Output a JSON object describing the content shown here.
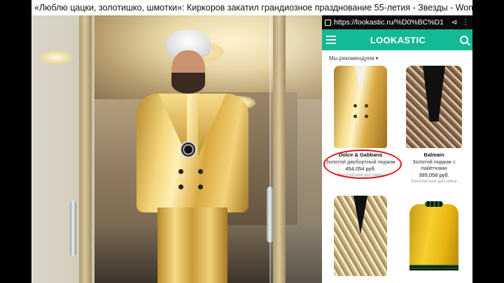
{
  "headline": "«Люблю цацки, золотишко, шмотки»: Киркоров закатил грандиозное празднование 55-летия - Звезды - WomanHit.ru",
  "browser": {
    "url": "https://lookastic.ru/%D0%BC%D1"
  },
  "app": {
    "brand": "LOOKASTIC",
    "sort_label": "Мы рекомендуем",
    "accent_color": "#13b894"
  },
  "products": [
    {
      "brand": "Dolce & Gabbana",
      "description": "Золотой двубортный пиджак",
      "price": "454,054 руб.",
      "shipping": "Бесплатная доставка"
    },
    {
      "brand": "Balmain",
      "description": "Золотой пиджак с пайетками",
      "price": "399,058 руб.",
      "shipping": "Бесплатная доставка"
    },
    {
      "brand": "",
      "description": "",
      "price": "",
      "shipping": ""
    },
    {
      "brand": "",
      "description": "",
      "price": "",
      "shipping": ""
    }
  ],
  "highlight_color": "#e01212"
}
